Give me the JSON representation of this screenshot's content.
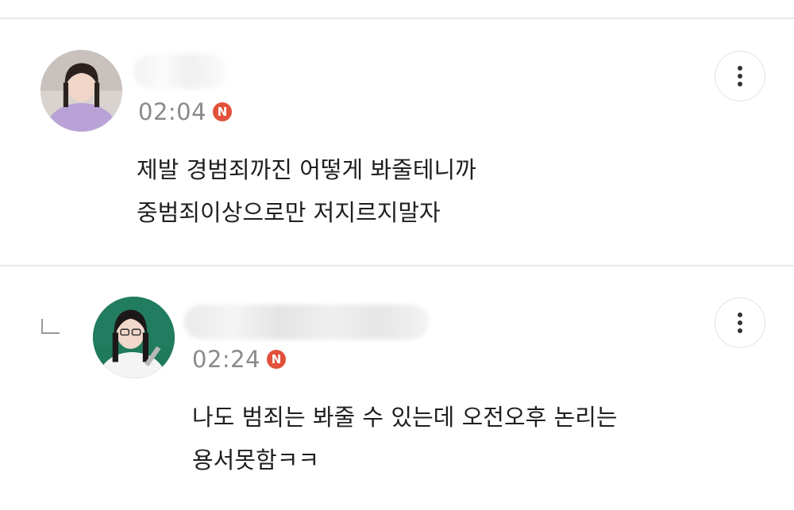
{
  "comments": [
    {
      "time": "02:04",
      "badge": "N",
      "lines": [
        "제발 경범죄까진 어떻게 봐줄테니까",
        "중범죄이상으로만 저지르지말자"
      ]
    },
    {
      "time": "02:24",
      "badge": "N",
      "lines": [
        "나도 범죄는 봐줄 수 있는데 오전오후 논리는",
        "용서못함ㅋㅋ"
      ]
    }
  ],
  "colors": {
    "badge": "#e2513b",
    "timestamp": "#8a8a8a",
    "divider": "#e9e9e9"
  },
  "icons": [
    "avatar-image",
    "more-options-icon",
    "reply-arrow-icon",
    "new-badge"
  ]
}
